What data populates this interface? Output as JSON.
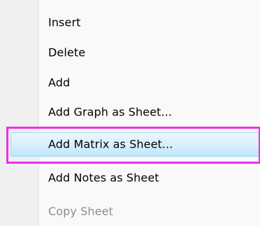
{
  "context_menu": {
    "items": [
      {
        "label": "Insert",
        "state": "normal"
      },
      {
        "label": "Delete",
        "state": "normal"
      },
      {
        "label": "Add",
        "state": "normal"
      },
      {
        "label": "Add Graph as Sheet...",
        "state": "normal"
      },
      {
        "label": "Add Matrix as Sheet...",
        "state": "selected"
      },
      {
        "label": "Add Notes as Sheet",
        "state": "normal"
      },
      {
        "label": "Copy Sheet",
        "state": "disabled"
      }
    ],
    "colors": {
      "highlight_border": "#a8d8eb",
      "highlight_fill": "#d9f0fc",
      "annotation_frame": "#ee2ded",
      "disabled_text": "#8d8d8d"
    }
  }
}
